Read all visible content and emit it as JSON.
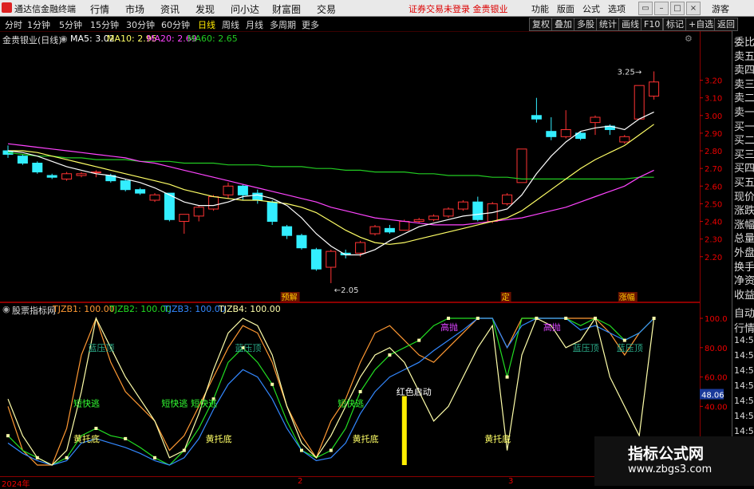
{
  "topbar": {
    "app_title": "通达信金融终端",
    "menus": [
      "行情",
      "市场",
      "资讯",
      "发现",
      "问小达",
      "财富圈",
      "交易"
    ],
    "notice": "证券交易未登录  金贵银业",
    "right_menus": [
      "功能",
      "版面",
      "公式",
      "选项"
    ],
    "account": "游客"
  },
  "periods": [
    "分时",
    "1分钟",
    "5分钟",
    "15分钟",
    "30分钟",
    "60分钟",
    "日线",
    "周线",
    "月线",
    "多周期",
    "更多"
  ],
  "active_period": "日线",
  "toolbar": [
    "复权",
    "叠加",
    "多股",
    "统计",
    "画线",
    "F10",
    "标记",
    "+自选",
    "返回"
  ],
  "main_legend": {
    "name": "金贵银业(日线)",
    "ma5": "MA5: 3.02",
    "ma10": "MA10: 2.95",
    "ma20": "MA20: 2.69",
    "ma60": "MA60: 2.65"
  },
  "sub_legend": {
    "name": "股票指标网",
    "z1": "TJZB1: 100.00",
    "z2": "TJZB2: 100.00",
    "z3": "TJZB3: 100.00",
    "z4": "TJZB4: 100.00"
  },
  "price_axis": [
    "3.20",
    "3.10",
    "3.00",
    "2.90",
    "2.80",
    "2.70",
    "2.60",
    "2.50",
    "2.40",
    "2.30",
    "2.20"
  ],
  "price_annotations": {
    "high": "3.25",
    "low": "2.05"
  },
  "event_tags": [
    "预解",
    "定",
    "涨幅"
  ],
  "sub_axis": [
    "100.0",
    "80.00",
    "60.00",
    "40.00"
  ],
  "sub_current": "48.06",
  "sub_labels": {
    "blue_pressure": "蓝压顶",
    "escape": "短快逃",
    "yellow_support": "黄托底",
    "red_start": "红色启动",
    "rise": "高抛"
  },
  "right_panel": [
    "委比",
    "卖五",
    "卖四",
    "卖三",
    "卖二",
    "卖一",
    "买一",
    "买二",
    "买三",
    "买四",
    "买五",
    "现价",
    "涨跌",
    "涨幅",
    "总量",
    "外盘",
    "换手",
    "净资",
    "收益"
  ],
  "right_panel2": [
    "自动",
    "行情",
    "14:50",
    "14:50",
    "14:50",
    "14:50",
    "14:50",
    "14:50",
    "14:50",
    "14:50"
  ],
  "bottom_axis": [
    "2024年",
    "2",
    "3"
  ],
  "watermark": {
    "title": "指标公式网",
    "url": "www.zbgs3.com"
  },
  "colors": {
    "ma5": "#ffffff",
    "ma10": "#ffff66",
    "ma20": "#ff44ff",
    "ma60": "#22cc22",
    "up": "#ff3333",
    "down": "#33eeff"
  },
  "chart_data": {
    "type": "candlestick",
    "ylim": [
      2.05,
      3.3
    ],
    "candles": [
      {
        "o": 2.8,
        "c": 2.78,
        "h": 2.83,
        "l": 2.76
      },
      {
        "o": 2.77,
        "c": 2.73,
        "h": 2.78,
        "l": 2.72
      },
      {
        "o": 2.73,
        "c": 2.68,
        "h": 2.74,
        "l": 2.67
      },
      {
        "o": 2.66,
        "c": 2.65,
        "h": 2.67,
        "l": 2.64
      },
      {
        "o": 2.64,
        "c": 2.67,
        "h": 2.68,
        "l": 2.63
      },
      {
        "o": 2.66,
        "c": 2.67,
        "h": 2.68,
        "l": 2.65
      },
      {
        "o": 2.68,
        "c": 2.68,
        "h": 2.69,
        "l": 2.65
      },
      {
        "o": 2.66,
        "c": 2.63,
        "h": 2.67,
        "l": 2.62
      },
      {
        "o": 2.63,
        "c": 2.58,
        "h": 2.64,
        "l": 2.57
      },
      {
        "o": 2.58,
        "c": 2.56,
        "h": 2.59,
        "l": 2.55
      },
      {
        "o": 2.52,
        "c": 2.55,
        "h": 2.56,
        "l": 2.51
      },
      {
        "o": 2.56,
        "c": 2.41,
        "h": 2.56,
        "l": 2.4
      },
      {
        "o": 2.4,
        "c": 2.44,
        "h": 2.44,
        "l": 2.33
      },
      {
        "o": 2.43,
        "c": 2.48,
        "h": 2.49,
        "l": 2.4
      },
      {
        "o": 2.47,
        "c": 2.54,
        "h": 2.55,
        "l": 2.46
      },
      {
        "o": 2.55,
        "c": 2.6,
        "h": 2.62,
        "l": 2.53
      },
      {
        "o": 2.6,
        "c": 2.55,
        "h": 2.61,
        "l": 2.52
      },
      {
        "o": 2.56,
        "c": 2.52,
        "h": 2.58,
        "l": 2.5
      },
      {
        "o": 2.51,
        "c": 2.4,
        "h": 2.52,
        "l": 2.38
      },
      {
        "o": 2.37,
        "c": 2.32,
        "h": 2.38,
        "l": 2.3
      },
      {
        "o": 2.32,
        "c": 2.25,
        "h": 2.33,
        "l": 2.24
      },
      {
        "o": 2.24,
        "c": 2.13,
        "h": 2.25,
        "l": 2.12
      },
      {
        "o": 2.14,
        "c": 2.23,
        "h": 2.24,
        "l": 2.05
      },
      {
        "o": 2.22,
        "c": 2.21,
        "h": 2.24,
        "l": 2.19
      },
      {
        "o": 2.22,
        "c": 2.28,
        "h": 2.29,
        "l": 2.2
      },
      {
        "o": 2.33,
        "c": 2.37,
        "h": 2.38,
        "l": 2.32
      },
      {
        "o": 2.36,
        "c": 2.34,
        "h": 2.38,
        "l": 2.33
      },
      {
        "o": 2.35,
        "c": 2.4,
        "h": 2.41,
        "l": 2.35
      },
      {
        "o": 2.4,
        "c": 2.41,
        "h": 2.42,
        "l": 2.39
      },
      {
        "o": 2.41,
        "c": 2.43,
        "h": 2.44,
        "l": 2.4
      },
      {
        "o": 2.43,
        "c": 2.47,
        "h": 2.48,
        "l": 2.42
      },
      {
        "o": 2.47,
        "c": 2.51,
        "h": 2.52,
        "l": 2.46
      },
      {
        "o": 2.51,
        "c": 2.41,
        "h": 2.54,
        "l": 2.4
      },
      {
        "o": 2.4,
        "c": 2.5,
        "h": 2.51,
        "l": 2.39
      },
      {
        "o": 2.5,
        "c": 2.55,
        "h": 2.56,
        "l": 2.49
      },
      {
        "o": 2.62,
        "c": 2.81,
        "h": 2.81,
        "l": 2.62
      },
      {
        "o": 3.0,
        "c": 2.98,
        "h": 3.1,
        "l": 2.96
      },
      {
        "o": 2.91,
        "c": 2.88,
        "h": 2.99,
        "l": 2.86
      },
      {
        "o": 2.88,
        "c": 2.92,
        "h": 3.03,
        "l": 2.87
      },
      {
        "o": 2.9,
        "c": 2.87,
        "h": 2.91,
        "l": 2.86
      },
      {
        "o": 2.96,
        "c": 2.99,
        "h": 3.0,
        "l": 2.89
      },
      {
        "o": 2.94,
        "c": 2.92,
        "h": 2.95,
        "l": 2.89
      },
      {
        "o": 2.85,
        "c": 2.88,
        "h": 2.89,
        "l": 2.84
      },
      {
        "o": 2.98,
        "c": 3.17,
        "h": 3.17,
        "l": 2.98
      },
      {
        "o": 3.11,
        "c": 3.19,
        "h": 3.25,
        "l": 3.09
      }
    ],
    "ma": {
      "ma5": [
        2.8,
        2.79,
        2.77,
        2.74,
        2.71,
        2.69,
        2.67,
        2.66,
        2.64,
        2.62,
        2.59,
        2.55,
        2.51,
        2.49,
        2.49,
        2.51,
        2.54,
        2.55,
        2.53,
        2.49,
        2.42,
        2.33,
        2.26,
        2.21,
        2.21,
        2.24,
        2.29,
        2.33,
        2.37,
        2.39,
        2.41,
        2.43,
        2.44,
        2.45,
        2.47,
        2.55,
        2.67,
        2.77,
        2.85,
        2.91,
        2.93,
        2.94,
        2.92,
        2.98,
        3.02
      ],
      "ma10": [
        2.8,
        2.8,
        2.79,
        2.77,
        2.75,
        2.73,
        2.71,
        2.69,
        2.67,
        2.65,
        2.63,
        2.61,
        2.58,
        2.56,
        2.54,
        2.53,
        2.52,
        2.52,
        2.51,
        2.5,
        2.48,
        2.45,
        2.4,
        2.35,
        2.31,
        2.28,
        2.27,
        2.28,
        2.3,
        2.32,
        2.34,
        2.36,
        2.38,
        2.4,
        2.42,
        2.46,
        2.52,
        2.58,
        2.64,
        2.7,
        2.75,
        2.79,
        2.83,
        2.89,
        2.95
      ],
      "ma20": [
        2.84,
        2.83,
        2.82,
        2.81,
        2.8,
        2.79,
        2.78,
        2.77,
        2.76,
        2.74,
        2.73,
        2.71,
        2.69,
        2.67,
        2.65,
        2.63,
        2.61,
        2.59,
        2.57,
        2.55,
        2.53,
        2.51,
        2.48,
        2.46,
        2.44,
        2.42,
        2.41,
        2.4,
        2.39,
        2.38,
        2.38,
        2.38,
        2.39,
        2.4,
        2.41,
        2.42,
        2.44,
        2.46,
        2.48,
        2.51,
        2.54,
        2.57,
        2.6,
        2.65,
        2.69
      ],
      "ma60": [
        2.79,
        2.78,
        2.77,
        2.77,
        2.76,
        2.76,
        2.75,
        2.75,
        2.75,
        2.74,
        2.74,
        2.74,
        2.73,
        2.73,
        2.73,
        2.72,
        2.72,
        2.72,
        2.71,
        2.71,
        2.71,
        2.7,
        2.7,
        2.69,
        2.69,
        2.68,
        2.68,
        2.68,
        2.67,
        2.67,
        2.66,
        2.66,
        2.66,
        2.65,
        2.65,
        2.64,
        2.64,
        2.64,
        2.64,
        2.64,
        2.64,
        2.64,
        2.64,
        2.65,
        2.65
      ]
    },
    "indicator": {
      "ylim": [
        0,
        100
      ],
      "series": [
        {
          "name": "TJZB1",
          "values": [
            40,
            10,
            0,
            0,
            25,
            75,
            100,
            70,
            50,
            40,
            30,
            10,
            20,
            40,
            60,
            80,
            95,
            90,
            70,
            40,
            20,
            5,
            30,
            45,
            70,
            90,
            95,
            85,
            75,
            70,
            80,
            90,
            100,
            100,
            80,
            100,
            100,
            100,
            100,
            100,
            100,
            90,
            75,
            90,
            100
          ]
        },
        {
          "name": "TJZB2",
          "values": [
            20,
            10,
            5,
            0,
            5,
            20,
            25,
            20,
            18,
            12,
            5,
            0,
            10,
            25,
            45,
            70,
            80,
            70,
            55,
            30,
            10,
            5,
            10,
            25,
            50,
            65,
            75,
            80,
            85,
            95,
            100,
            100,
            100,
            100,
            60,
            100,
            100,
            100,
            100,
            95,
            100,
            95,
            85,
            90,
            100
          ]
        },
        {
          "name": "TJZB3",
          "values": [
            15,
            8,
            3,
            0,
            3,
            15,
            18,
            15,
            12,
            8,
            3,
            0,
            5,
            18,
            38,
            55,
            65,
            60,
            45,
            25,
            10,
            3,
            5,
            15,
            35,
            50,
            60,
            65,
            70,
            78,
            85,
            92,
            100,
            100,
            80,
            95,
            100,
            100,
            100,
            92,
            95,
            90,
            85,
            90,
            100
          ]
        },
        {
          "name": "TJZB4",
          "values": [
            45,
            20,
            5,
            0,
            10,
            50,
            100,
            80,
            60,
            45,
            30,
            5,
            10,
            35,
            65,
            90,
            100,
            95,
            75,
            40,
            15,
            5,
            20,
            40,
            60,
            75,
            80,
            70,
            50,
            30,
            40,
            60,
            80,
            95,
            10,
            75,
            100,
            95,
            80,
            85,
            100,
            60,
            40,
            20,
            100
          ]
        }
      ]
    }
  }
}
